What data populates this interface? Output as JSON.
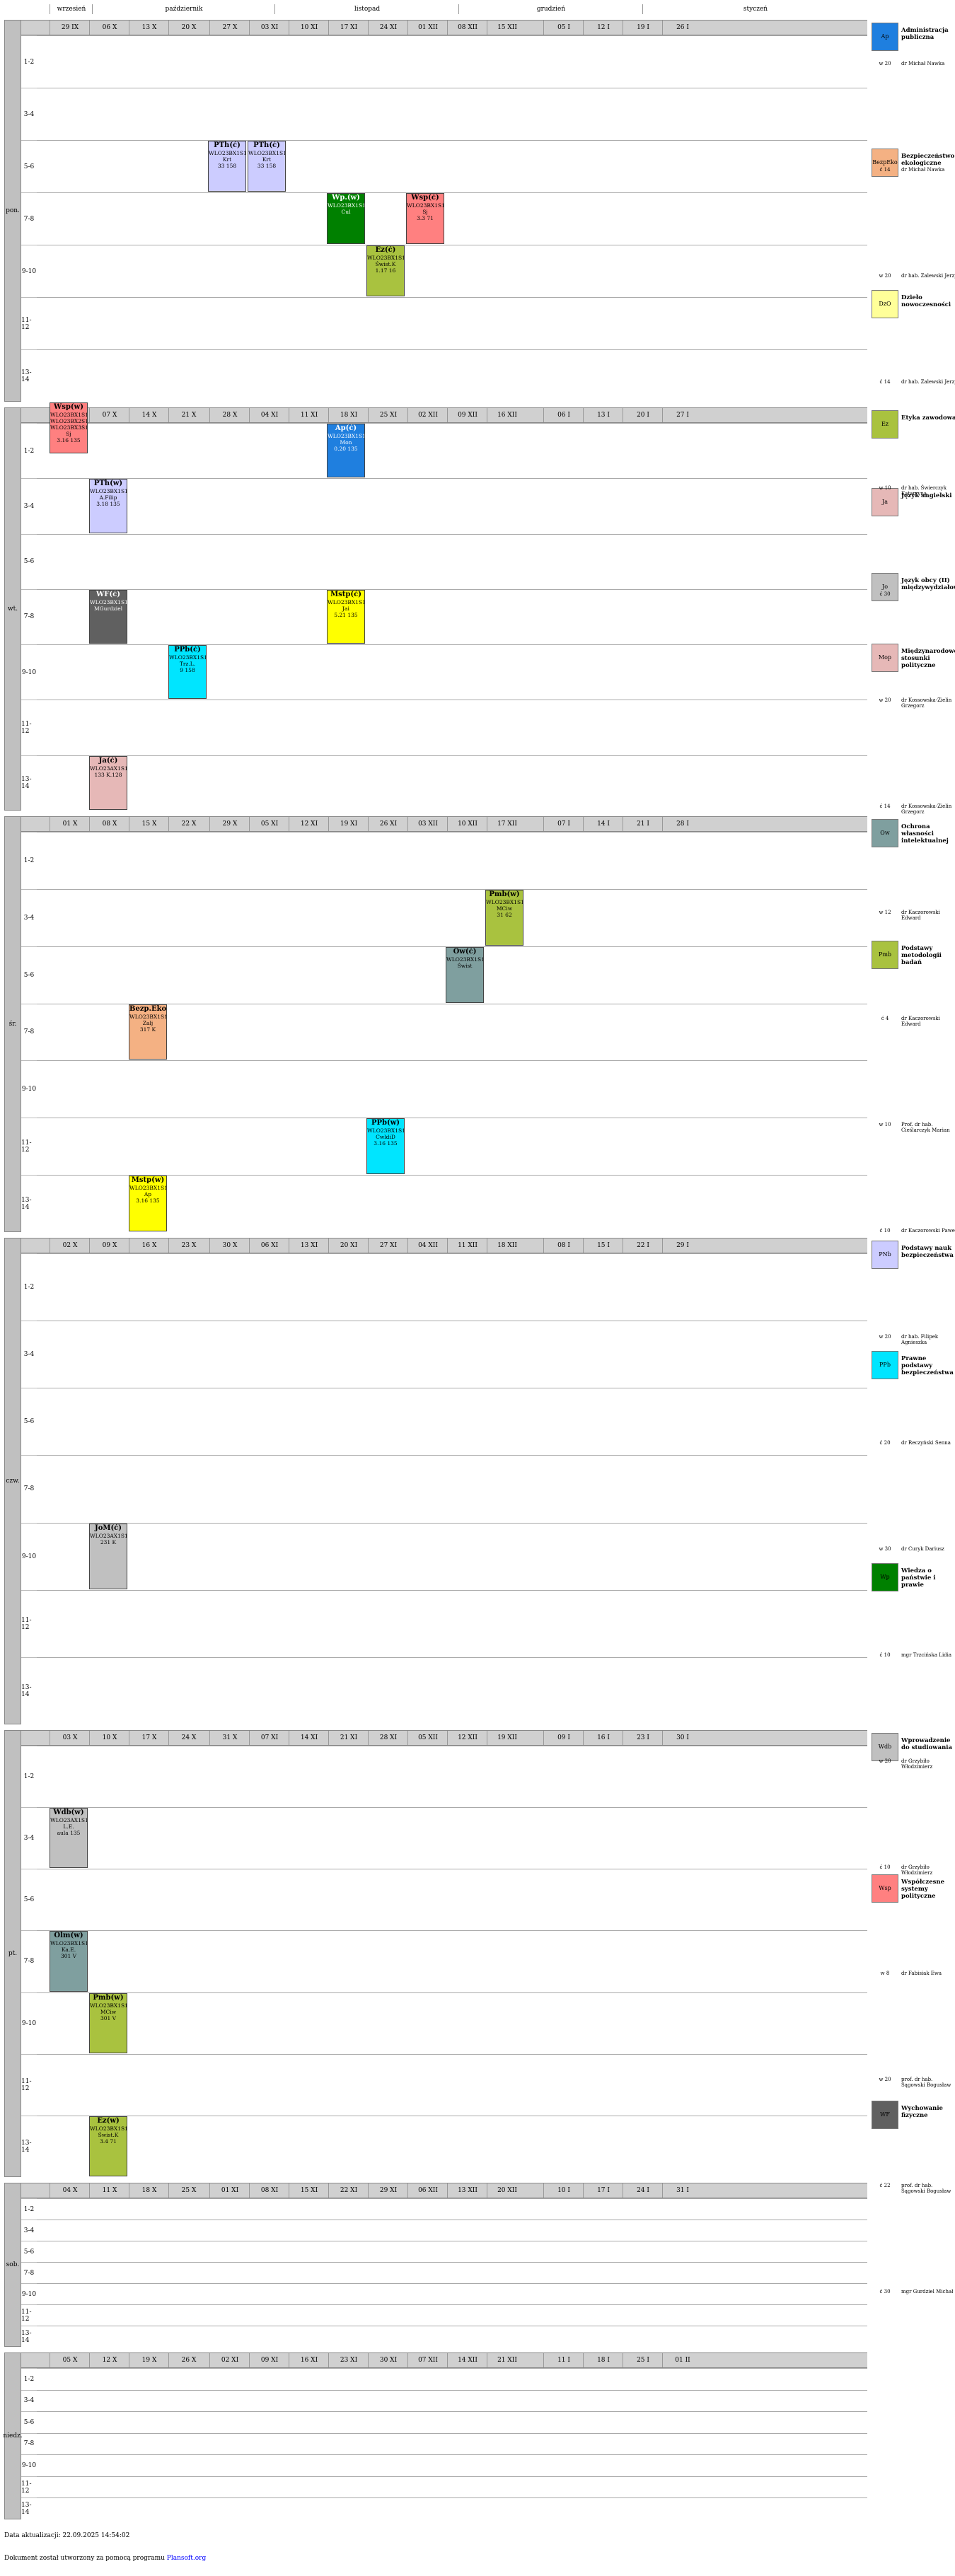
{
  "months": [
    "wrzesień",
    "październik",
    "listopad",
    "grudzień",
    "styczeń"
  ],
  "days": [
    {
      "key": "pon",
      "label": "pon."
    },
    {
      "key": "wt",
      "label": "wt."
    },
    {
      "key": "sr",
      "label": "śr."
    },
    {
      "key": "czw",
      "label": "czw."
    },
    {
      "key": "pt",
      "label": "pt."
    },
    {
      "key": "sob",
      "label": "sob."
    },
    {
      "key": "niedz",
      "label": "niedz."
    }
  ],
  "date_rows": {
    "pon": [
      "29 IX",
      "06 X",
      "13 X",
      "20 X",
      "27 X",
      "03 XI",
      "10 XI",
      "17 XI",
      "24 XI",
      "01 XII",
      "08 XII",
      "15 XII",
      "05 I",
      "12 I",
      "19 I",
      "26 I"
    ],
    "wt": [
      "30 IX",
      "07 X",
      "14 X",
      "21 X",
      "28 X",
      "04 XI",
      "11 XI",
      "18 XI",
      "25 XI",
      "02 XII",
      "09 XII",
      "16 XII",
      "06 I",
      "13 I",
      "20 I",
      "27 I"
    ],
    "sr": [
      "01 X",
      "08 X",
      "15 X",
      "22 X",
      "29 X",
      "05 XI",
      "12 XI",
      "19 XI",
      "26 XI",
      "03 XII",
      "10 XII",
      "17 XII",
      "07 I",
      "14 I",
      "21 I",
      "28 I"
    ],
    "czw": [
      "02 X",
      "09 X",
      "16 X",
      "23 X",
      "30 X",
      "06 XI",
      "13 XI",
      "20 XI",
      "27 XI",
      "04 XII",
      "11 XII",
      "18 XII",
      "08 I",
      "15 I",
      "22 I",
      "29 I"
    ],
    "pt": [
      "03 X",
      "10 X",
      "17 X",
      "24 X",
      "31 X",
      "07 XI",
      "14 XI",
      "21 XI",
      "28 XI",
      "05 XII",
      "12 XII",
      "19 XII",
      "09 I",
      "16 I",
      "23 I",
      "30 I"
    ],
    "sob": [
      "04 X",
      "11 X",
      "18 X",
      "25 X",
      "01 XI",
      "08 XI",
      "15 XI",
      "22 XI",
      "29 XI",
      "06 XII",
      "13 XII",
      "20 XII",
      "10 I",
      "17 I",
      "24 I",
      "31 I"
    ],
    "niedz": [
      "05 X",
      "12 X",
      "19 X",
      "26 X",
      "02 XI",
      "09 XI",
      "16 XI",
      "23 XI",
      "30 XI",
      "07 XII",
      "14 XII",
      "21 XII",
      "11 I",
      "18 I",
      "25 I",
      "01 II"
    ]
  },
  "slots": [
    "1-2",
    "3-4",
    "5-6",
    "7-8",
    "9-10",
    "11-12",
    "13-14"
  ],
  "subjects": [
    {
      "code": "Ap",
      "name": "Administracja publiczna",
      "color": "#1f7fdf",
      "day": "pon"
    },
    {
      "code": "BezpEko",
      "name": "Bezpieczeństwo ekologiczne",
      "color": "#f4b183",
      "day": "pon"
    },
    {
      "code": "DzO",
      "name": "Dzieło nowoczesności",
      "color": "#ffff99",
      "day": "pon"
    },
    {
      "code": "Ez",
      "name": "Etyka zawodowa",
      "color": "#a9c23f",
      "day": "wt"
    },
    {
      "code": "Ja",
      "name": "Język angielski",
      "color": "#e6b8b7",
      "day": "wt"
    },
    {
      "code": "Jo",
      "name": "Język obcy (II) międzywydziałowy",
      "color": "#c0c0c0",
      "day": "wt"
    },
    {
      "code": "Mop",
      "name": "Międzynarodowe stosunki polityczne",
      "color": "#e6b8b7",
      "day": "wt"
    },
    {
      "code": "Ow",
      "name": "Ochrona własności intelektualnej",
      "color": "#7f9f9f",
      "day": "sr"
    },
    {
      "code": "Pmb",
      "name": "Podstawy metodologii badań",
      "color": "#a9c23f",
      "day": "sr"
    },
    {
      "code": "PNb",
      "name": "Podstawy nauk bezpieczeństwa",
      "color": "#ccccff",
      "day": "czw"
    },
    {
      "code": "PPb",
      "name": "Prawne podstawy bezpieczeństwa",
      "color": "#00e5ff",
      "day": "czw"
    },
    {
      "code": "Wp",
      "name": "Wiedza o państwie i prawie",
      "color": "#008000",
      "day": "czw"
    },
    {
      "code": "Wdb",
      "name": "Wprowadzenie do studiowania",
      "color": "#c0c0c0",
      "day": "pt"
    },
    {
      "code": "Wsp",
      "name": "Współczesne systemy polityczne",
      "color": "#ff8080",
      "day": "pt"
    },
    {
      "code": "WF",
      "name": "Wychowanie fizyczne",
      "color": "#606060",
      "day": "pt"
    }
  ],
  "teachers": [
    {
      "text": "w 20",
      "name": "dr Michał Nawka"
    },
    {
      "text": "ć 14",
      "name": "dr Michał Nawka"
    },
    {
      "text": "w 20",
      "name": "dr hab. Zalewski Jerzy"
    },
    {
      "text": "ć 14",
      "name": "dr hab. Zalewski Jerzy"
    },
    {
      "text": "w 10",
      "name": "dr hab. Świerczyk Katarzyna"
    },
    {
      "text": "ć 30",
      "name": ""
    },
    {
      "text": "w 20",
      "name": "dr Kossowska-Zielin Grzegorz"
    },
    {
      "text": "ć 14",
      "name": "dr Kossowska-Zielin Grzegorz"
    },
    {
      "text": "w 12",
      "name": "dr Kaczorowski Edward"
    },
    {
      "text": "ć 4",
      "name": "dr Kaczorowski Edward"
    },
    {
      "text": "w 10",
      "name": "Prof. dr hab. Cieślarczyk Marian"
    },
    {
      "text": "ć 10",
      "name": "dr Kaczorowski Paweł"
    },
    {
      "text": "w 20",
      "name": "dr hab. Filipek Agnieszka"
    },
    {
      "text": "ć 20",
      "name": "dr Reczyński Senna"
    },
    {
      "text": "w 30",
      "name": "dr Curyk Dariusz"
    },
    {
      "text": "ć 10",
      "name": "mgr Trzcińska Lidia"
    },
    {
      "text": "w 20",
      "name": "dr Grzybiło Włodzimierz"
    },
    {
      "text": "ć 10",
      "name": "dr Grzybiło Włodzimierz"
    },
    {
      "text": "w 8",
      "name": "dr Fabisiak Ewa"
    },
    {
      "text": "w 20",
      "name": "prof. dr hab. Sągowski Bogusław"
    },
    {
      "text": "ć 22",
      "name": "prof. dr hab. Sągowski Bogusław"
    },
    {
      "text": "ć 30",
      "name": "mgr Gurdziel Michał"
    }
  ],
  "cells": [
    {
      "t": "Wsp(w)",
      "g": "WLO23BX1S1\nWLO23BX2S1\nWLO23BX3S1",
      "r": "Sj",
      "p": "3.16 135",
      "c": "#ff8080"
    },
    {
      "t": "Wsp(w)",
      "g": "WLO23BX1S1\nWLO23BX2S1\nWLO23BX3S1",
      "r": "Sj",
      "p": "3.16 135",
      "c": "#ff8080"
    },
    {
      "t": "PTh(ć)",
      "g": "WLO23BX1S1",
      "r": "Krt",
      "p": "33 158",
      "c": "#ccccff"
    },
    {
      "t": "PTh(ć)",
      "g": "WLO23BX1S1",
      "r": "Krt",
      "p": "33 158",
      "c": "#ccccff"
    },
    {
      "t": "PTh(ć)",
      "g": "WLO23BX1S1",
      "r": "Krt",
      "p": "33 158",
      "c": "#ccccff"
    },
    {
      "t": "Wp.(w)",
      "g": "WLO23BX1S1",
      "r": "Cul",
      "p": "",
      "c": "#008000"
    },
    {
      "t": "Ez(ć)",
      "g": "WLO23BX1S1",
      "r": "Świst.K",
      "p": "1.17 16",
      "c": "#a9c23f"
    },
    {
      "t": "Wsp(ć)",
      "g": "WLO23BX1S1",
      "r": "Sj",
      "p": "3.3 71",
      "c": "#ff8080"
    },
    {
      "t": "Ap(ć)",
      "g": "WLO23BX1S1",
      "r": "Mon",
      "p": "0.20 135",
      "c": "#1f7fdf"
    },
    {
      "t": "WF(ć)",
      "g": "WLO23BX1S1",
      "r": "MGurdziel",
      "p": "",
      "c": "#606060"
    },
    {
      "t": "Mstp(ć)",
      "g": "WLO23BX1S1",
      "r": "Jai",
      "p": "5.21 135",
      "c": "#ffff00"
    },
    {
      "t": "PTh(w)",
      "g": "WLO23BX1S1",
      "r": "A.Filip",
      "p": "3.18 135",
      "c": "#ccccff"
    },
    {
      "t": "PPb(ć)",
      "g": "WLO23BX1S1",
      "r": "Trz.L.",
      "p": "9 158",
      "c": "#00e5ff"
    },
    {
      "t": "Ja(ć)",
      "g": "WLO23AX1S1",
      "r": "133 K.128",
      "p": "",
      "c": "#e6b8b7"
    },
    {
      "t": "Pmb(w)",
      "g": "WLO23BX1S1",
      "r": "MCiw",
      "p": "31 62",
      "c": "#a9c23f"
    },
    {
      "t": "Ow(ć)",
      "g": "WLO23BX1S1",
      "r": "Świst",
      "p": "",
      "c": "#7f9f9f"
    },
    {
      "t": "Bezp.Eko(w)",
      "g": "WLO23BX1S1",
      "r": "Zalj",
      "p": "317 K",
      "c": "#f4b183"
    },
    {
      "t": "Mstp(w)",
      "g": "WLO23BX1S1",
      "r": "Ap",
      "p": "3.16 135",
      "c": "#ffff00"
    },
    {
      "t": "PPb(w)",
      "g": "WLO23BX1S1",
      "r": "CwldiD",
      "p": "3.16 135",
      "c": "#00e5ff"
    },
    {
      "t": "JoM(ć)",
      "g": "WLO23AX1S1",
      "r": "231 K",
      "p": "",
      "c": "#c0c0c0"
    },
    {
      "t": "Wdb(w)",
      "g": "WLO23AX1S1",
      "r": "L.E.",
      "p": "aula 135",
      "c": "#c0c0c0"
    },
    {
      "t": "Olm(w)",
      "g": "WLO23BX1S1",
      "r": "Ka.E.",
      "p": "301 V",
      "c": "#7f9f9f"
    },
    {
      "t": "Pmb(w)",
      "g": "WLO23BX1S1",
      "r": "MCiw",
      "p": "301 V",
      "c": "#a9c23f"
    },
    {
      "t": "Ez(w)",
      "g": "WLO23BX1S1",
      "r": "Świst.K",
      "p": "3.4 71",
      "c": "#a9c23f"
    }
  ],
  "footer": {
    "updated": "Data aktualizacji: 22.09.2025 14:54:02",
    "generated": "Dokument został utworzony za pomocą programu",
    "link": "Plansoft.org"
  }
}
